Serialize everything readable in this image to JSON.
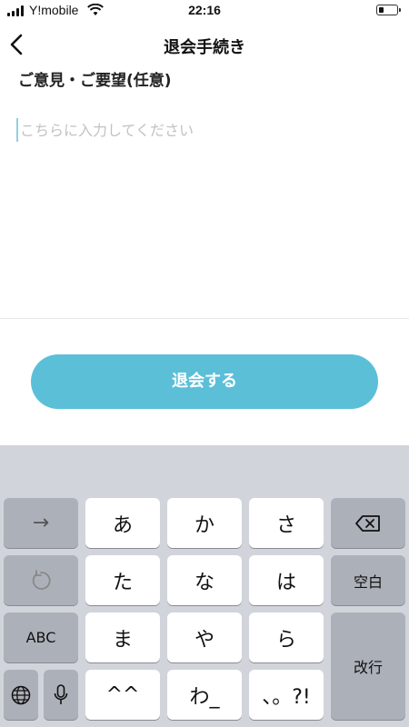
{
  "status_bar": {
    "carrier": "Y!mobile",
    "time": "22:16"
  },
  "nav": {
    "title": "退会手続き"
  },
  "form": {
    "section_heading": "ご意見・ご要望(任意)",
    "placeholder": "こちらに入力してください"
  },
  "actions": {
    "withdraw_label": "退会する",
    "accent_color": "#5bbfd8"
  },
  "keyboard": {
    "row1": [
      "→",
      "あ",
      "か",
      "さ",
      "⌫"
    ],
    "row2": [
      "↺",
      "た",
      "な",
      "は",
      "空白"
    ],
    "row3": [
      "ABC",
      "ま",
      "や",
      "ら"
    ],
    "row4": [
      "🌐",
      "mic",
      "^^",
      "わ_",
      "、。?!"
    ],
    "enter_label": "改行"
  }
}
